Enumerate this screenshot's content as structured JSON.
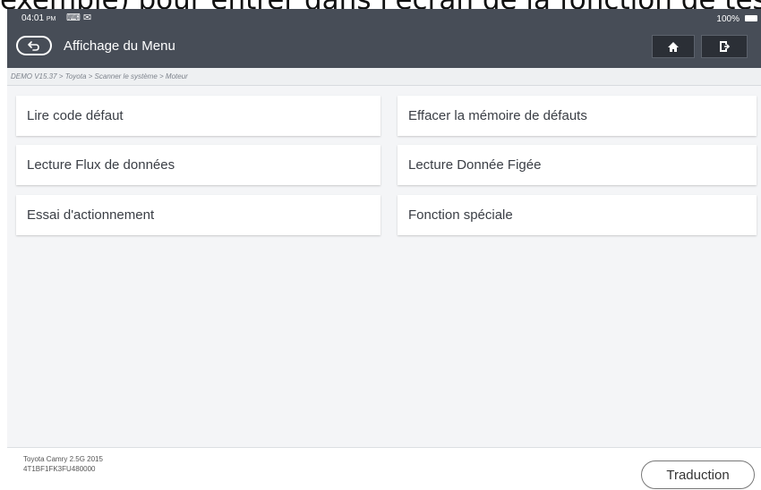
{
  "caption": "exemple) pour entrer dans l'écran de la fonction de test",
  "status": {
    "time": "04:01",
    "ampm": "PM",
    "battery": "100%"
  },
  "header": {
    "title": "Affichage du Menu"
  },
  "breadcrumb": "DEMO V15.37 > Toyota > Scanner le système > Moteur",
  "menu": {
    "items": [
      "Lire code défaut",
      "Effacer la mémoire de défauts",
      "Lecture Flux de données",
      "Lecture Donnée Figée",
      "Essai d'actionnement",
      "Fonction spéciale"
    ]
  },
  "footer": {
    "vehicle": "Toyota Camry 2.5G 2015",
    "vin": "4T1BF1FK3FU480000",
    "translate_label": "Traduction"
  },
  "colors": {
    "header_bg": "#474d57",
    "button_bg": "#2b2f36",
    "menu_bg": "#f4f5f7"
  },
  "icons": {
    "back": "back-arrow-icon",
    "home": "home-icon",
    "exit": "exit-icon",
    "wifi": "wifi-icon",
    "mail": "mail-icon",
    "battery": "battery-icon"
  }
}
